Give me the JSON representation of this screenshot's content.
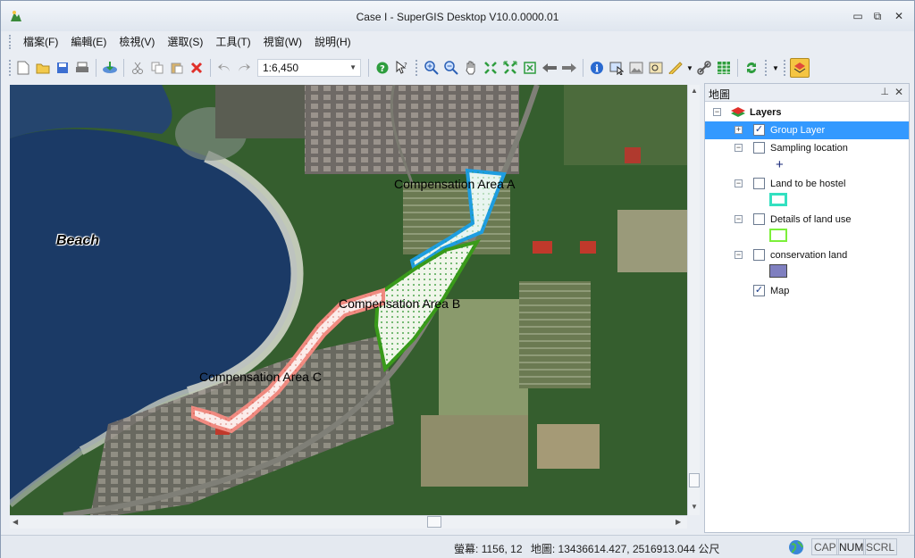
{
  "window": {
    "title": "Case I - SuperGIS Desktop V10.0.0000.01"
  },
  "menu": [
    "檔案(F)",
    "編輯(E)",
    "檢視(V)",
    "選取(S)",
    "工具(T)",
    "視窗(W)",
    "說明(H)"
  ],
  "toolbar": {
    "scale": "1:6,450"
  },
  "map": {
    "labels": {
      "beach": "Beach",
      "area_a": "Compensation Area  A",
      "area_b": "Compensation Area  B",
      "area_c": "Compensation Area  C"
    }
  },
  "panel": {
    "title": "地圖",
    "root": "Layers",
    "layers": [
      {
        "label": "Group Layer",
        "checked": true
      },
      {
        "label": "Sampling location",
        "checked": false
      },
      {
        "label": "Land to be hostel",
        "checked": false
      },
      {
        "label": "Details of land use",
        "checked": false
      },
      {
        "label": "conservation land",
        "checked": false
      },
      {
        "label": "Map",
        "checked": true
      }
    ],
    "symbol_colors": {
      "hostel": "#33e0c0",
      "land_use": "#7cf03a",
      "conservation": "#7f7fc0"
    }
  },
  "status": {
    "screen_label": "螢幕:",
    "screen_value": "1156, 12",
    "map_label": "地圖:",
    "map_value": "13436614.427, 2516913.044 公尺",
    "keys": [
      "CAP",
      "NUM",
      "SCRL"
    ]
  }
}
